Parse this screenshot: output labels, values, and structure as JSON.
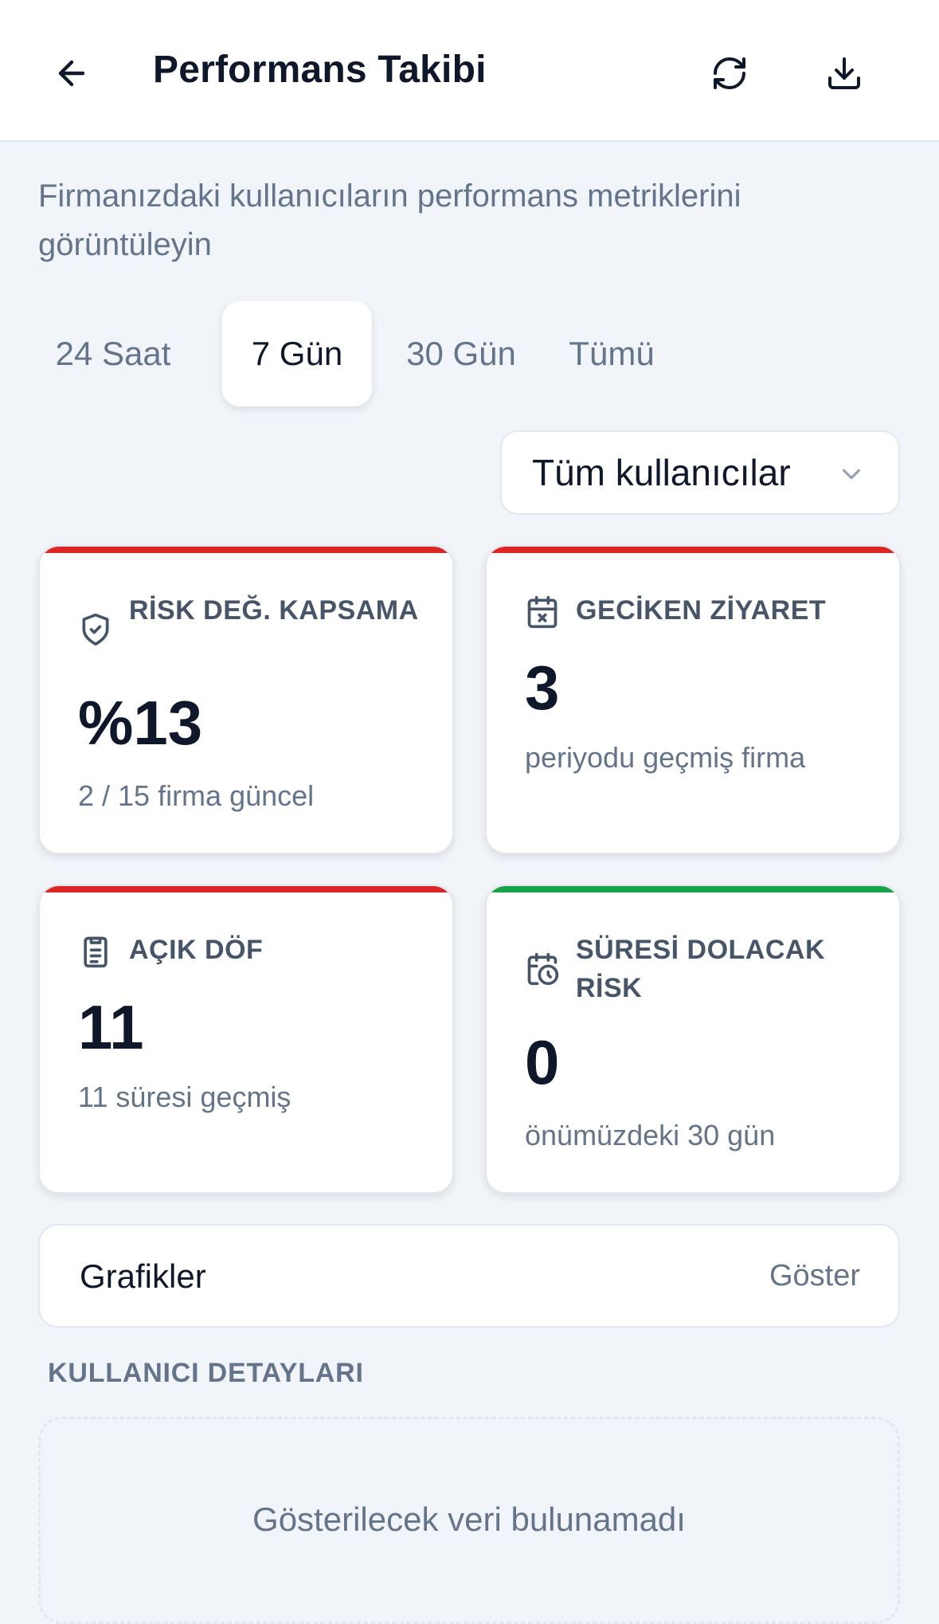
{
  "header": {
    "title": "Performans Takibi",
    "back_icon": "arrow-left-icon",
    "refresh_icon": "refresh-icon",
    "download_icon": "download-icon"
  },
  "subtitle": "Firmanızdaki kullanıcıların performans metriklerini görüntüleyin",
  "tabs": [
    {
      "label": "24 Saat",
      "active": false
    },
    {
      "label": "7 Gün",
      "active": true
    },
    {
      "label": "30 Gün",
      "active": false
    },
    {
      "label": "Tümü",
      "active": false
    }
  ],
  "user_filter": {
    "selected": "Tüm kullanıcılar"
  },
  "cards": [
    {
      "icon": "shield-check-icon",
      "label": "RİSK DEĞ. KAPSAMA",
      "value": "%13",
      "sub": "2 / 15 firma güncel",
      "accent": "#dc2626"
    },
    {
      "icon": "calendar-x-icon",
      "label": "GECİKEN ZİYARET",
      "value": "3",
      "sub": "periyodu geçmiş firma",
      "accent": "#dc2626"
    },
    {
      "icon": "clipboard-list-icon",
      "label": "AÇIK DÖF",
      "value": "11",
      "sub": "11 süresi geçmiş",
      "accent": "#dc2626"
    },
    {
      "icon": "calendar-clock-icon",
      "label": "SÜRESİ DOLACAK RİSK",
      "value": "0",
      "sub": "önümüzdeki 30 gün",
      "accent": "#16a34a"
    }
  ],
  "charts": {
    "title": "Grafikler",
    "toggle": "Göster"
  },
  "user_details": {
    "title": "KULLANICI DETAYLARI",
    "empty": "Gösterilecek veri bulunamadı"
  },
  "colors": {
    "background": "#f1f5f9",
    "card": "#ffffff",
    "danger": "#dc2626",
    "success": "#16a34a",
    "muted": "#64748b"
  }
}
